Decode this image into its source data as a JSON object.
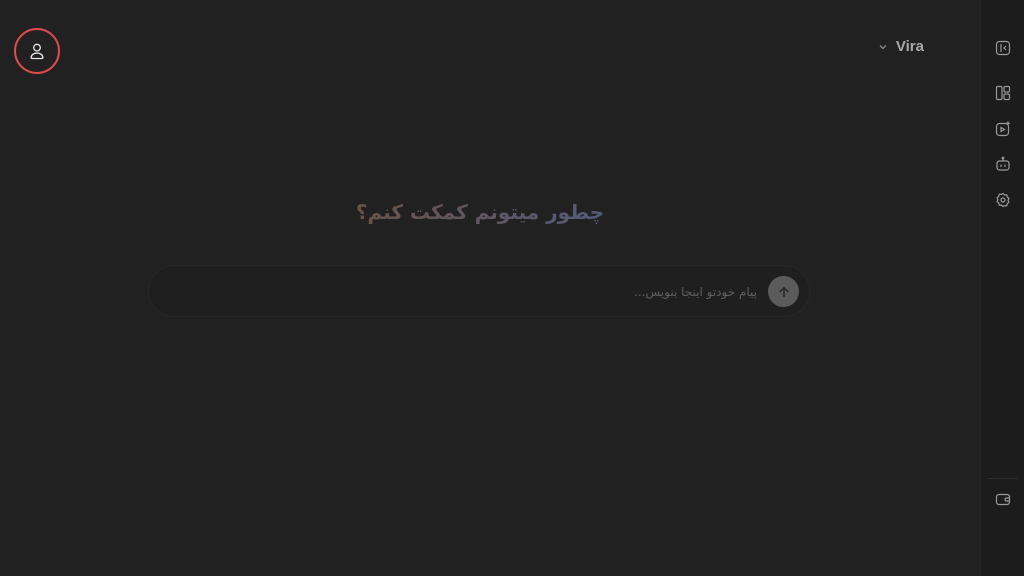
{
  "header": {
    "profile_icon": "user-icon",
    "model_name": "Vira",
    "model_chevron_icon": "chevron-down-icon"
  },
  "main": {
    "greeting": "چطور میتونم کمکت کنم؟",
    "composer": {
      "placeholder": "پیام خودتو اینجا بنویس...",
      "value": "",
      "send_icon": "arrow-up-icon"
    }
  },
  "rail": {
    "items": [
      {
        "icon": "collapse-panel-icon"
      },
      {
        "icon": "layout-icon"
      },
      {
        "icon": "video-add-icon"
      },
      {
        "icon": "robot-icon"
      },
      {
        "icon": "settings-badge-icon"
      }
    ],
    "bottom_icon": "wallet-icon"
  },
  "colors": {
    "background": "#212121",
    "rail_background": "#1c1c1c",
    "profile_highlight": "#e04a4a",
    "send_button": "#5b5b5b"
  }
}
